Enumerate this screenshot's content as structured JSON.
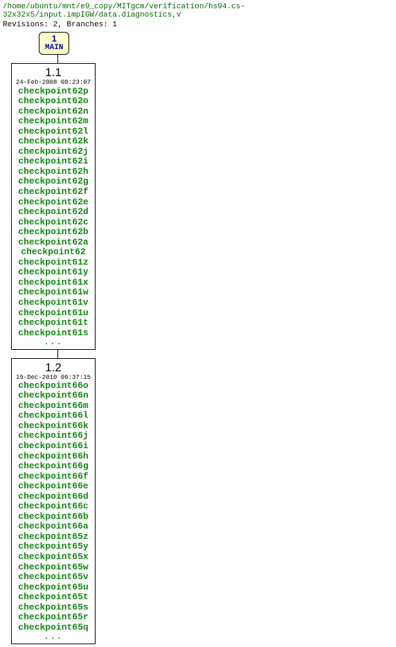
{
  "header": {
    "path": "/home/ubuntu/mnt/e9_copy/MITgcm/verification/hs94.cs-32x32x5/input.impIGW/data.diagnostics,v",
    "stats": "Revisions: 2, Branches: 1"
  },
  "branch": {
    "number": "1",
    "name": "MAIN"
  },
  "revisions": [
    {
      "version": "1.1",
      "timestamp": "24-Feb-2008 00:23:07",
      "tags": [
        "checkpoint62p",
        "checkpoint62o",
        "checkpoint62n",
        "checkpoint62m",
        "checkpoint62l",
        "checkpoint62k",
        "checkpoint62j",
        "checkpoint62i",
        "checkpoint62h",
        "checkpoint62g",
        "checkpoint62f",
        "checkpoint62e",
        "checkpoint62d",
        "checkpoint62c",
        "checkpoint62b",
        "checkpoint62a",
        "checkpoint62",
        "checkpoint61z",
        "checkpoint61y",
        "checkpoint61x",
        "checkpoint61w",
        "checkpoint61v",
        "checkpoint61u",
        "checkpoint61t",
        "checkpoint61s"
      ],
      "truncated": true
    },
    {
      "version": "1.2",
      "timestamp": "19-Dec-2010 00:37:15",
      "tags": [
        "checkpoint66o",
        "checkpoint66n",
        "checkpoint66m",
        "checkpoint66l",
        "checkpoint66k",
        "checkpoint66j",
        "checkpoint66i",
        "checkpoint66h",
        "checkpoint66g",
        "checkpoint66f",
        "checkpoint66e",
        "checkpoint66d",
        "checkpoint66c",
        "checkpoint66b",
        "checkpoint66a",
        "checkpoint65z",
        "checkpoint65y",
        "checkpoint65x",
        "checkpoint65w",
        "checkpoint65v",
        "checkpoint65u",
        "checkpoint65t",
        "checkpoint65s",
        "checkpoint65r",
        "checkpoint65q"
      ],
      "truncated": true
    }
  ],
  "ellipsis": "..."
}
